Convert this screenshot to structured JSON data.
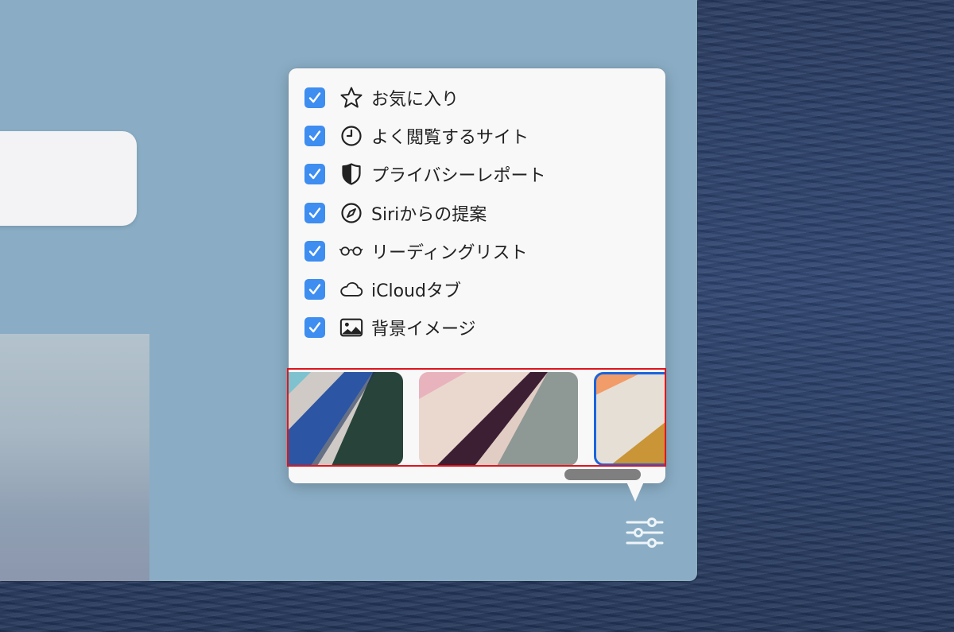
{
  "colors": {
    "accent_checkbox": "#3e8df0",
    "selection_ring": "#1a64dd",
    "highlight_box": "#e0141c",
    "window_bg": "#8aadc5"
  },
  "popover": {
    "options": [
      {
        "label": "お気に入り",
        "icon": "star-icon",
        "checked": true
      },
      {
        "label": "よく閲覧するサイト",
        "icon": "clock-icon",
        "checked": true
      },
      {
        "label": "プライバシーレポート",
        "icon": "shield-icon",
        "checked": true
      },
      {
        "label": "Siriからの提案",
        "icon": "compass-icon",
        "checked": true
      },
      {
        "label": "リーディングリスト",
        "icon": "glasses-icon",
        "checked": true
      },
      {
        "label": "iCloudタブ",
        "icon": "cloud-icon",
        "checked": true
      },
      {
        "label": "背景イメージ",
        "icon": "photo-icon",
        "checked": true
      }
    ],
    "background_thumbnails": [
      {
        "name": "blue-green",
        "selected": false
      },
      {
        "name": "pink-purple",
        "selected": false
      },
      {
        "name": "orange-gold",
        "selected": true
      }
    ]
  },
  "toolbar": {
    "settings_icon": "sliders-icon"
  }
}
